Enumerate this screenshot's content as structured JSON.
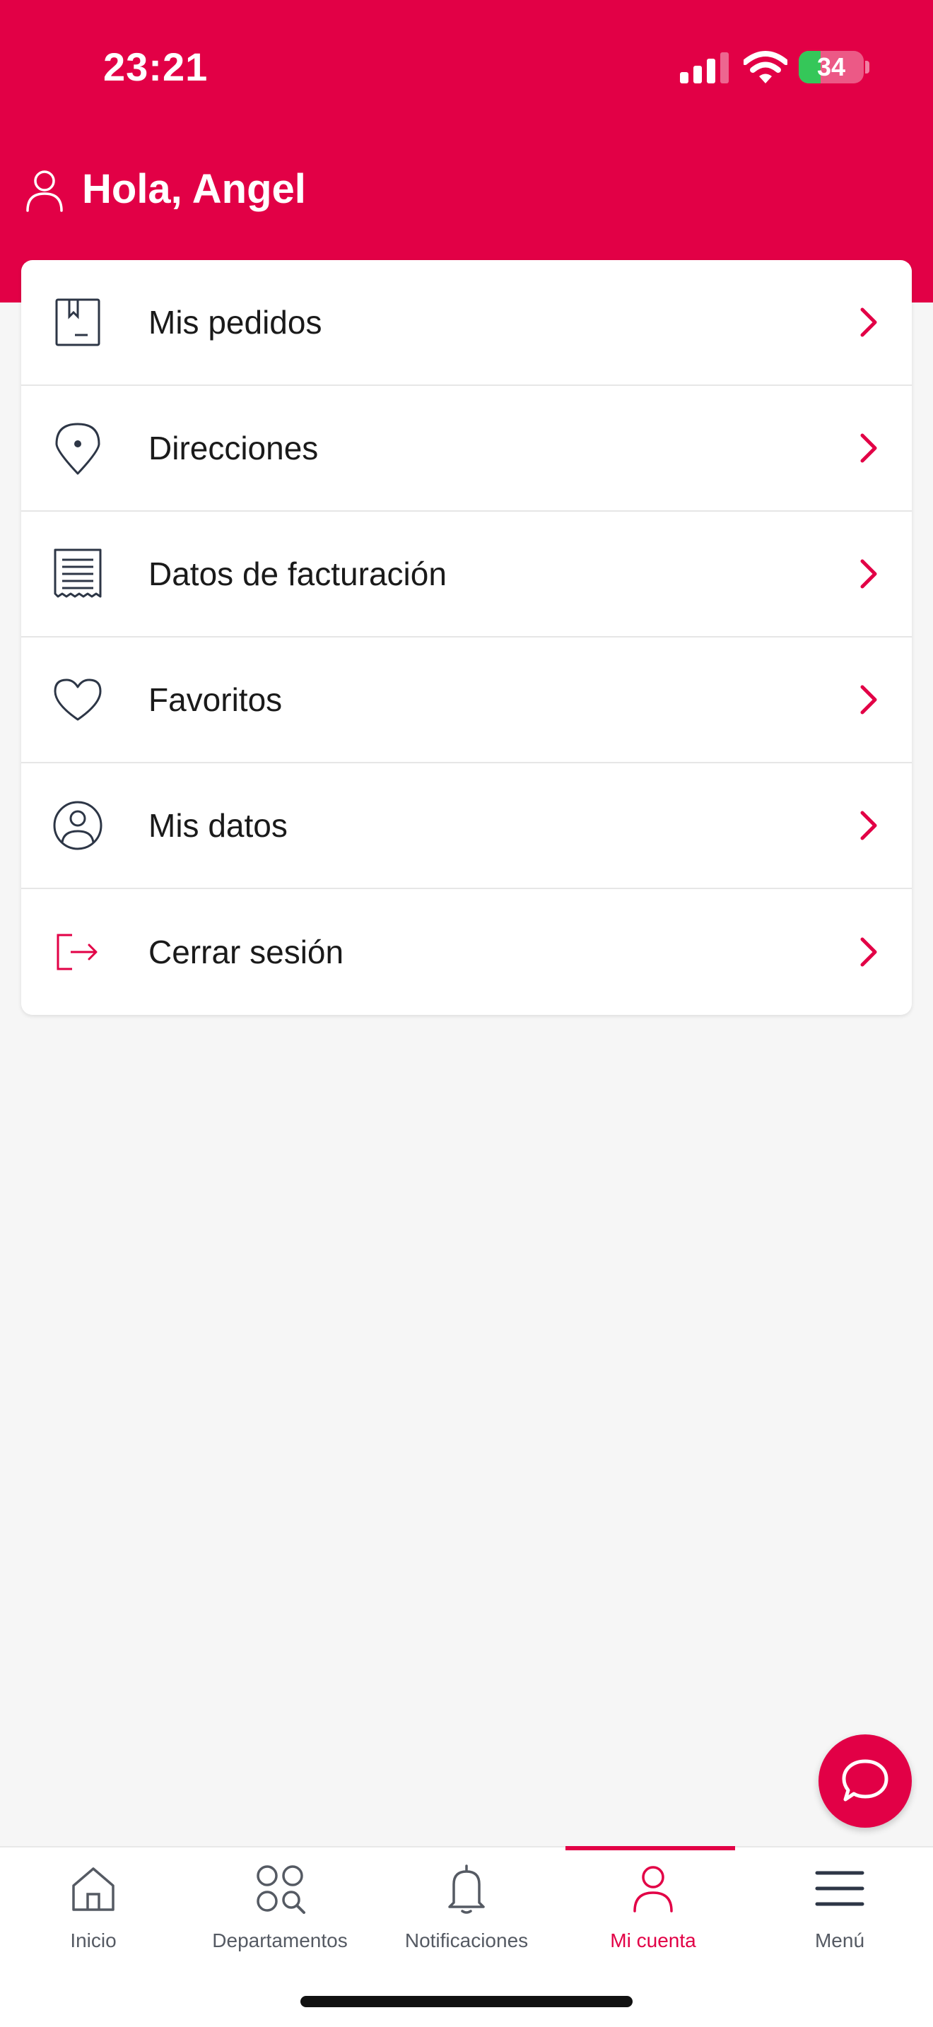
{
  "status_bar": {
    "time": "23:21",
    "battery_percent": "34",
    "battery_level": 0.34
  },
  "header": {
    "greeting": "Hola, Angel"
  },
  "menu": {
    "items": [
      {
        "label": "Mis pedidos",
        "icon": "bookmark-book-icon"
      },
      {
        "label": "Direcciones",
        "icon": "location-pin-icon"
      },
      {
        "label": "Datos de facturación",
        "icon": "receipt-icon"
      },
      {
        "label": "Favoritos",
        "icon": "heart-icon"
      },
      {
        "label": "Mis datos",
        "icon": "user-circle-icon"
      },
      {
        "label": "Cerrar sesión",
        "icon": "logout-icon"
      }
    ]
  },
  "tabbar": {
    "tabs": [
      {
        "label": "Inicio",
        "icon": "home-icon",
        "active": false
      },
      {
        "label": "Departamentos",
        "icon": "departments-grid-icon",
        "active": false
      },
      {
        "label": "Notificaciones",
        "icon": "bell-icon",
        "active": false
      },
      {
        "label": "Mi cuenta",
        "icon": "user-icon",
        "active": true
      },
      {
        "label": "Menú",
        "icon": "hamburger-menu-icon",
        "active": false
      }
    ]
  },
  "colors": {
    "brand": "#e20046",
    "background": "#f6f6f6",
    "icon_dark": "#2d3646",
    "tab_inactive": "#555a63"
  }
}
